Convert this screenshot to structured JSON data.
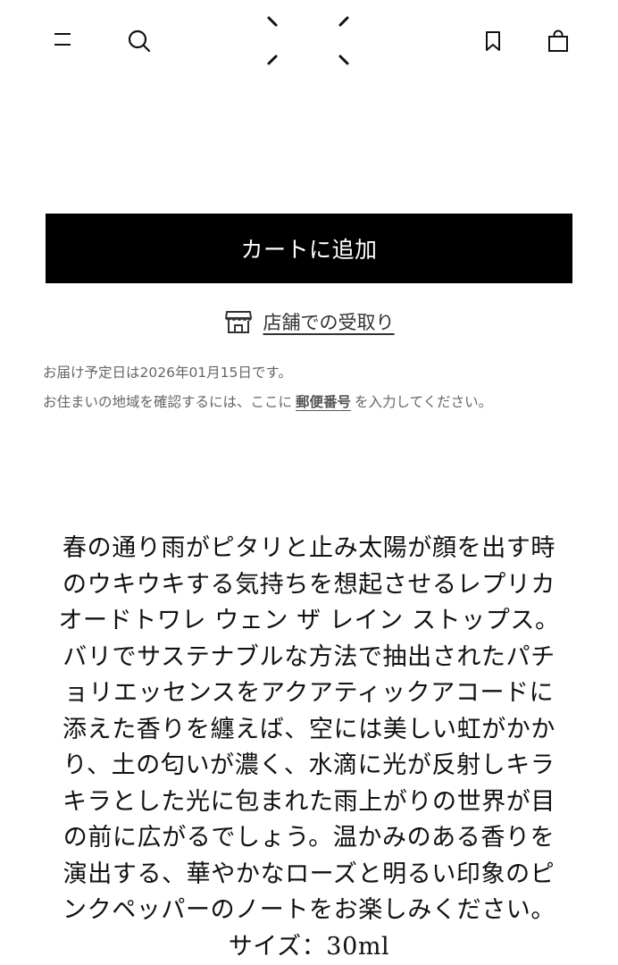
{
  "header": {
    "menu_icon": "hamburger-menu-icon",
    "search_icon": "search-icon",
    "logo_icon": "brand-logo-bracket-mark",
    "bookmark_icon": "bookmark-icon",
    "bag_icon": "shopping-bag-icon"
  },
  "cart": {
    "add_to_cart_label": "カートに追加"
  },
  "pickup": {
    "icon": "store-icon",
    "label": "店舗での受取り"
  },
  "delivery": {
    "date_text": "お届け予定日は2026年01月15日です。",
    "postal_prefix": "お住まいの地域を確認するには、ここに",
    "postal_link": "郵便番号",
    "postal_suffix": "を入力してください。"
  },
  "description": {
    "text": "春の通り雨がピタリと止み太陽が顔を出す時のウキウキする気持ちを想起させるレプリカ オードトワレ ウェン ザ レイン ストップス。バリでサステナブルな方法で抽出されたパチョリエッセンスをアクアティックアコードに添えた香りを纏えば、空には美しい虹がかかり、土の匂いが濃く、水滴に光が反射しキラキラとした光に包まれた雨上がりの世界が目の前に広がるでしょう。温かみのある香りを演出する、華やかなローズと明るい印象のピンクペッパーのノートをお楽しみください。サイズ：30ml"
  }
}
